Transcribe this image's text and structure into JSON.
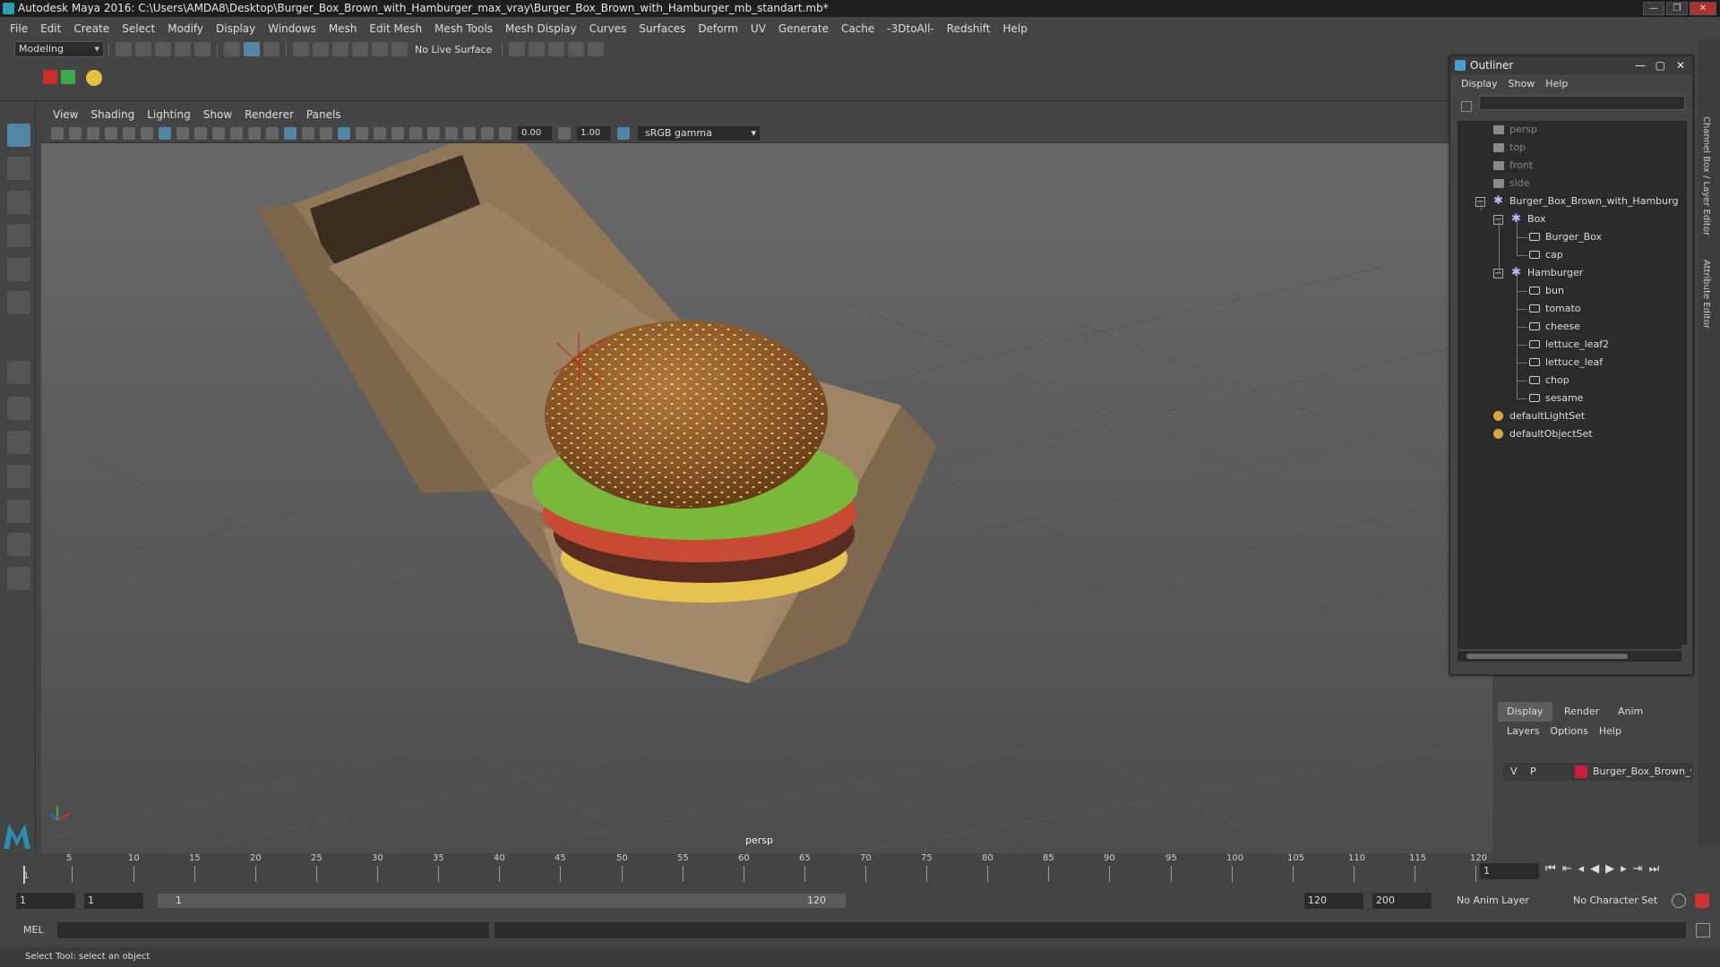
{
  "window": {
    "title": "Autodesk Maya 2016: C:\\Users\\AMDA8\\Desktop\\Burger_Box_Brown_with_Hamburger_max_vray\\Burger_Box_Brown_with_Hamburger_mb_standart.mb*",
    "btn_min": "—",
    "btn_max": "❐",
    "btn_close": "✕"
  },
  "menubar": [
    "File",
    "Edit",
    "Create",
    "Select",
    "Modify",
    "Display",
    "Windows",
    "Mesh",
    "Edit Mesh",
    "Mesh Tools",
    "Mesh Display",
    "Curves",
    "Surfaces",
    "Deform",
    "UV",
    "Generate",
    "Cache",
    "-3DtoAll-",
    "Redshift",
    "Help"
  ],
  "shelf": {
    "mode": "Modeling",
    "live_surface": "No Live Surface"
  },
  "viewport": {
    "menus": [
      "View",
      "Shading",
      "Lighting",
      "Show",
      "Renderer",
      "Panels"
    ],
    "exposure": "0.00",
    "gamma": "1.00",
    "color_space": "sRGB gamma",
    "camera_label": "persp"
  },
  "outliner": {
    "title": "Outliner",
    "menus": [
      "Display",
      "Show",
      "Help"
    ],
    "items": [
      {
        "label": "persp"
      },
      {
        "label": "top"
      },
      {
        "label": "front"
      },
      {
        "label": "side"
      },
      {
        "label": "Burger_Box_Brown_with_Hamburg"
      },
      {
        "label": "Box"
      },
      {
        "label": "Burger_Box"
      },
      {
        "label": "cap"
      },
      {
        "label": "Hamburger"
      },
      {
        "label": "bun"
      },
      {
        "label": "tomato"
      },
      {
        "label": "cheese"
      },
      {
        "label": "lettuce_leaf2"
      },
      {
        "label": "lettuce_leaf"
      },
      {
        "label": "chop"
      },
      {
        "label": "sesame"
      },
      {
        "label": "defaultLightSet"
      },
      {
        "label": "defaultObjectSet"
      }
    ]
  },
  "right_tabs": {
    "channel_box": "Channel Box / Layer Editor",
    "attribute_editor": "Attribute Editor"
  },
  "layers": {
    "tabs": [
      "Display",
      "Render",
      "Anim"
    ],
    "menus": [
      "Layers",
      "Options",
      "Help"
    ],
    "row": {
      "v": "V",
      "p": "P",
      "name": "Burger_Box_Brown_with"
    }
  },
  "timeline": {
    "ticks": [
      "5",
      "10",
      "15",
      "20",
      "25",
      "30",
      "35",
      "40",
      "45",
      "50",
      "55",
      "60",
      "65",
      "70",
      "75",
      "80",
      "85",
      "90",
      "95",
      "100",
      "105",
      "110",
      "115",
      "120"
    ],
    "start_marker": "1",
    "current_frame": "1"
  },
  "range": {
    "start": "1",
    "start2": "1",
    "slider_start": "1",
    "slider_end": "120",
    "end": "120",
    "end2": "200",
    "anim_layer": "No Anim Layer",
    "char_set": "No Character Set"
  },
  "cmdline": {
    "label": "MEL"
  },
  "helpline": {
    "text": "Select Tool: select an object"
  }
}
